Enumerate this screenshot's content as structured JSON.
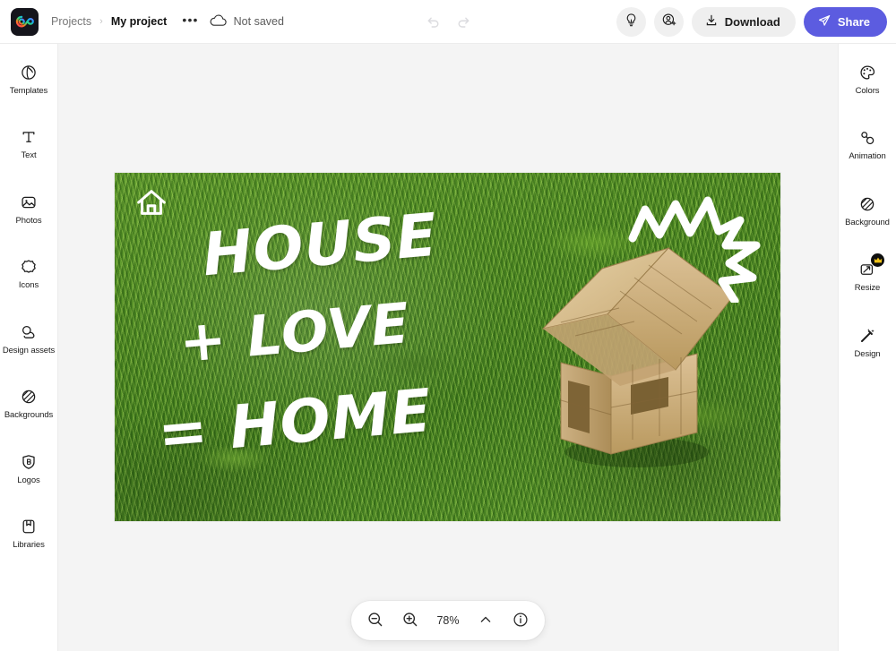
{
  "app": {
    "name": "Adobe Express",
    "logo_icon": "adobe-express-logo"
  },
  "header": {
    "breadcrumb": {
      "root": "Projects",
      "separator": "›",
      "current": "My project",
      "more_menu": "•••"
    },
    "save_status": "Not saved",
    "cloud_icon": "cloud-icon",
    "history": {
      "undo_icon": "undo-icon",
      "redo_icon": "redo-icon",
      "undo_label": "Undo",
      "redo_label": "Redo"
    },
    "actions": {
      "ideas_icon": "lightbulb-icon",
      "ideas_label": "Ideas",
      "invite_icon": "invite-person-icon",
      "invite_label": "Invite",
      "download_label": "Download",
      "download_icon": "download-icon",
      "share_label": "Share",
      "share_icon": "send-plane-icon",
      "share_color": "#5C5CE0"
    }
  },
  "left_rail": {
    "items": [
      {
        "label": "Templates",
        "icon": "templates-icon"
      },
      {
        "label": "Text",
        "icon": "text-t-icon"
      },
      {
        "label": "Photos",
        "icon": "photos-image-icon"
      },
      {
        "label": "Icons",
        "icon": "icons-shape-icon"
      },
      {
        "label": "Design assets",
        "icon": "design-assets-icon"
      },
      {
        "label": "Backgrounds",
        "icon": "backgrounds-hatch-icon"
      },
      {
        "label": "Logos",
        "icon": "logos-badge-icon"
      },
      {
        "label": "Libraries",
        "icon": "libraries-book-icon"
      }
    ]
  },
  "right_rail": {
    "items": [
      {
        "label": "Colors",
        "icon": "color-palette-icon",
        "premium": false
      },
      {
        "label": "Animation",
        "icon": "animation-icon",
        "premium": false
      },
      {
        "label": "Background",
        "icon": "background-hatch-icon",
        "premium": false
      },
      {
        "label": "Resize",
        "icon": "resize-icon",
        "premium": true,
        "badge_icon": "crown-icon"
      },
      {
        "label": "Design",
        "icon": "magic-wand-icon",
        "premium": false
      }
    ]
  },
  "canvas": {
    "background_color": "#3F7A1D",
    "artwork": {
      "photo_description": "wooden toy block house on green grass",
      "text_lines": [
        "HOUSE",
        "+ LOVE",
        "= HOME"
      ],
      "line_1": "HOUSE",
      "line_2": "+ LOVE",
      "line_3": "= HOME",
      "text_color": "#FFFFFF",
      "decorations": [
        {
          "name": "house-outline-sticker",
          "color": "#FFFFFF"
        },
        {
          "name": "zigzag-burst-sticker",
          "color": "#FFFFFF"
        }
      ]
    }
  },
  "zoombar": {
    "zoom_out_icon": "zoom-out-icon",
    "zoom_out_label": "Zoom out",
    "zoom_in_icon": "zoom-in-icon",
    "zoom_in_label": "Zoom in",
    "zoom_value": "78%",
    "expand_icon": "chevron-up-icon",
    "info_icon": "info-circle-icon"
  }
}
